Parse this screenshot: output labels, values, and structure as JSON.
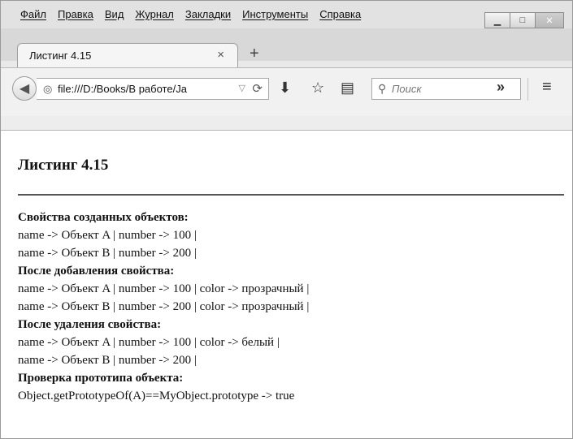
{
  "menu": [
    "Файл",
    "Правка",
    "Вид",
    "Журнал",
    "Закладки",
    "Инструменты",
    "Справка"
  ],
  "window_controls": {
    "minimize_icon": "minimize-icon",
    "maximize_icon": "maximize-icon",
    "close_icon": "close-icon"
  },
  "tab": {
    "title": "Листинг 4.15"
  },
  "navbar": {
    "url": "file:///D:/Books/В работе/Ja",
    "search_placeholder": "Поиск",
    "overflow": "»"
  },
  "page": {
    "heading": "Листинг 4.15",
    "lines": [
      {
        "text": "Свойства созданных объектов:",
        "bold": true
      },
      {
        "text": "name -> Объект A | number -> 100 |",
        "bold": false
      },
      {
        "text": "name -> Объект B | number -> 200 |",
        "bold": false
      },
      {
        "text": "После добавления свойства:",
        "bold": true
      },
      {
        "text": "name -> Объект A | number -> 100 | color -> прозрачный |",
        "bold": false
      },
      {
        "text": "name -> Объект B | number -> 200 | color -> прозрачный |",
        "bold": false
      },
      {
        "text": "После удаления свойства:",
        "bold": true
      },
      {
        "text": "name -> Объект A | number -> 100 | color -> белый |",
        "bold": false
      },
      {
        "text": "name -> Объект B | number -> 200 |",
        "bold": false
      },
      {
        "text": "Проверка прототипа объекта:",
        "bold": true
      },
      {
        "text": "Object.getPrototypeOf(A)==MyObject.prototype -> true",
        "bold": false
      }
    ]
  }
}
